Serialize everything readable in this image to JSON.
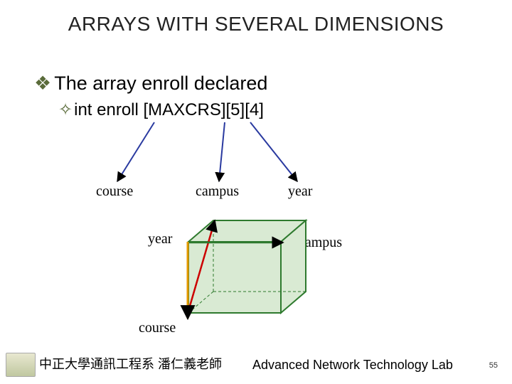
{
  "title": "ARRAYS WITH SEVERAL DIMENSIONS",
  "bullet1": "The array enroll declared",
  "bullet2": "int enroll [MAXCRS][5][4]",
  "labels": {
    "course_top": "course",
    "campus_top": "campus",
    "year_top": "year",
    "year_cube": "year",
    "campus_cube": "campus",
    "course_cube": "course"
  },
  "footer": {
    "left": "中正大學通訊工程系 潘仁義老師",
    "right": "Advanced Network Technology Lab",
    "page": "55"
  }
}
